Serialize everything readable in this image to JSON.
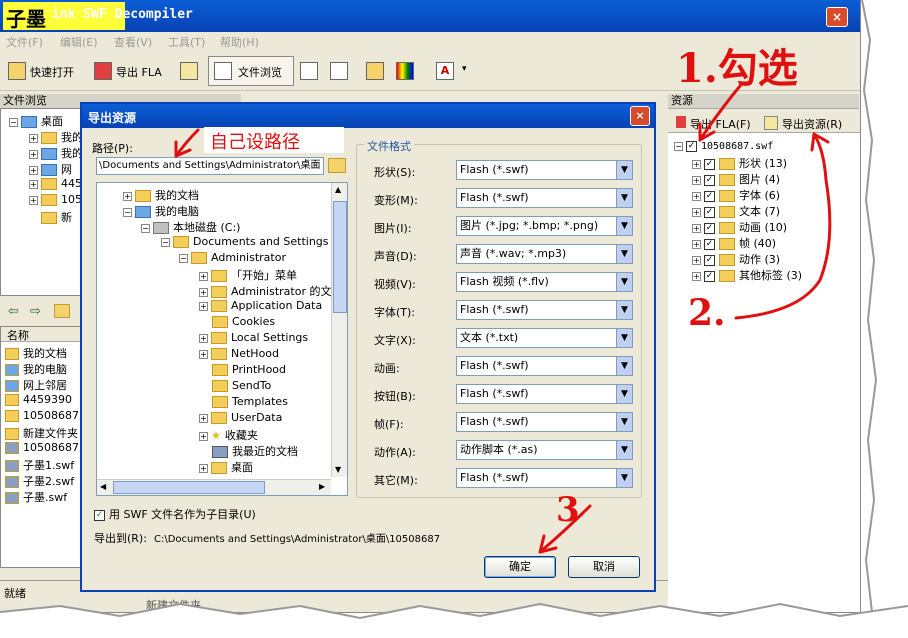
{
  "window": {
    "title_logo": "子墨",
    "title_text": "ink SWF Decompiler",
    "close_glyph": "×"
  },
  "menu": [
    "文件(F)",
    "编辑(E)",
    "查看(V)",
    "工具(T)",
    "帮助(H)"
  ],
  "toolbar": {
    "quick_open": "快速打开",
    "export_fla": "导出 FLA",
    "file_browse": "文件浏览"
  },
  "left_panel": {
    "title": "文件浏览",
    "tree": [
      {
        "label": "桌面",
        "icon": "desktop-icon"
      },
      {
        "label": "我的",
        "icon": "folder-icon"
      },
      {
        "label": "我的",
        "icon": "computer-icon"
      },
      {
        "label": "网",
        "icon": "network-icon"
      },
      {
        "label": "445",
        "icon": "folder-icon"
      },
      {
        "label": "105",
        "icon": "folder-icon"
      },
      {
        "label": "新",
        "icon": "folder-icon"
      }
    ],
    "list_header": "名称",
    "list": [
      "我的文档",
      "我的电脑",
      "网上邻居",
      "4459390",
      "10508687",
      "新建文件夹",
      "10508687.",
      "子墨1.swf",
      "子墨2.swf",
      "子墨.swf"
    ]
  },
  "status": {
    "ready": "就绪",
    "bottom_text": "新建文件夹"
  },
  "right_panel": {
    "title": "资源",
    "export_fla": "导出 FLA(F)",
    "export_res": "导出资源(R)",
    "root": "10508687.swf",
    "items": [
      {
        "label": "形状",
        "count": "(13)"
      },
      {
        "label": "图片",
        "count": "(4)"
      },
      {
        "label": "字体",
        "count": "(6)"
      },
      {
        "label": "文本",
        "count": "(7)"
      },
      {
        "label": "动画",
        "count": "(10)"
      },
      {
        "label": "帧",
        "count": "(40)"
      },
      {
        "label": "动作",
        "count": "(3)"
      },
      {
        "label": "其他标签",
        "count": "(3)"
      }
    ]
  },
  "dialog": {
    "title": "导出资源",
    "path_label": "路径(P):",
    "path_value": "\\Documents and Settings\\Administrator\\桌面",
    "tree": [
      {
        "label": "我的文档",
        "level": 1
      },
      {
        "label": "我的电脑",
        "level": 1
      },
      {
        "label": "本地磁盘 (C:)",
        "level": 2
      },
      {
        "label": "Documents and Settings",
        "level": 3
      },
      {
        "label": "Administrator",
        "level": 4
      },
      {
        "label": "「开始」菜单",
        "level": 5
      },
      {
        "label": "Administrator 的文档",
        "level": 5
      },
      {
        "label": "Application Data",
        "level": 5
      },
      {
        "label": "Cookies",
        "level": 5
      },
      {
        "label": "Local Settings",
        "level": 5
      },
      {
        "label": "NetHood",
        "level": 5
      },
      {
        "label": "PrintHood",
        "level": 5
      },
      {
        "label": "SendTo",
        "level": 5
      },
      {
        "label": "Templates",
        "level": 5
      },
      {
        "label": "UserData",
        "level": 5
      },
      {
        "label": "收藏夹",
        "level": 5
      },
      {
        "label": "我最近的文档",
        "level": 5
      },
      {
        "label": "桌面",
        "level": 5
      }
    ],
    "format_title": "文件格式",
    "formats": [
      {
        "label": "形状(S):",
        "value": "Flash (*.swf)"
      },
      {
        "label": "变形(M):",
        "value": "Flash (*.swf)"
      },
      {
        "label": "图片(I):",
        "value": "图片 (*.jpg; *.bmp; *.png)"
      },
      {
        "label": "声音(D):",
        "value": "声音 (*.wav; *.mp3)"
      },
      {
        "label": "视频(V):",
        "value": "Flash 视频 (*.flv)"
      },
      {
        "label": "字体(T):",
        "value": "Flash (*.swf)"
      },
      {
        "label": "文字(X):",
        "value": "文本 (*.txt)"
      },
      {
        "label": "动画:",
        "value": "Flash (*.swf)"
      },
      {
        "label": "按钮(B):",
        "value": "Flash (*.swf)"
      },
      {
        "label": "帧(F):",
        "value": "Flash (*.swf)"
      },
      {
        "label": "动作(A):",
        "value": "动作脚本 (*.as)"
      },
      {
        "label": "其它(M):",
        "value": "Flash (*.swf)"
      }
    ],
    "subdir_checkbox": "用 SWF 文件名作为子目录(U)",
    "export_to_label": "导出到(R):",
    "export_to_value": "C:\\Documents and Settings\\Administrator\\桌面\\10508687",
    "ok": "确定",
    "cancel": "取消"
  },
  "annotations": {
    "step1": "1.勾选",
    "step2": "2.",
    "step3": "3",
    "path_note": "自己设路径"
  }
}
